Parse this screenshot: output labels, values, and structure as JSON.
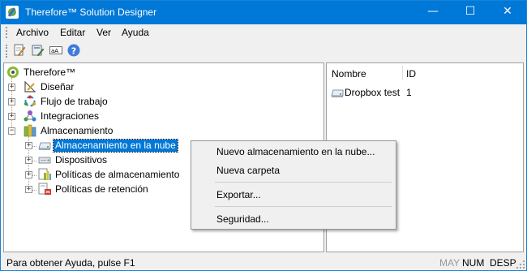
{
  "window": {
    "title": "Therefore™ Solution Designer",
    "controls": {
      "minimize": "—",
      "maximize": "☐",
      "close": "✕"
    }
  },
  "menubar": {
    "items": [
      "Archivo",
      "Editar",
      "Ver",
      "Ayuda"
    ]
  },
  "toolbar": {
    "buttons": [
      {
        "icon": "edit-document-icon"
      },
      {
        "icon": "edit-properties-icon"
      },
      {
        "icon": "rename-icon"
      },
      {
        "icon": "help-icon"
      }
    ]
  },
  "tree": {
    "root": {
      "label": "Therefore™",
      "icon": "therefore-root-icon"
    },
    "nodes": [
      {
        "label": "Diseñar",
        "icon": "design-icon",
        "expander": "+"
      },
      {
        "label": "Flujo de trabajo",
        "icon": "workflow-icon",
        "expander": "+"
      },
      {
        "label": "Integraciones",
        "icon": "integrations-icon",
        "expander": "+"
      },
      {
        "label": "Almacenamiento",
        "icon": "storage-icon",
        "expander": "−"
      }
    ],
    "storage_children": [
      {
        "label": "Almacenamiento en la nube",
        "icon": "cloud-storage-icon",
        "expander": "+",
        "selected": true
      },
      {
        "label": "Dispositivos",
        "icon": "devices-icon",
        "expander": "+"
      },
      {
        "label": "Políticas de almacenamiento",
        "icon": "storage-policies-icon",
        "expander": "+"
      },
      {
        "label": "Políticas de retención",
        "icon": "retention-policies-icon",
        "expander": "+"
      }
    ]
  },
  "list": {
    "columns": [
      "Nombre",
      "ID"
    ],
    "rows": [
      {
        "name": "Dropbox test",
        "id": "1",
        "icon": "cloud-storage-icon"
      }
    ]
  },
  "context_menu": {
    "items": [
      "Nuevo almacenamiento en la nube...",
      "Nueva carpeta",
      "Exportar...",
      "Seguridad..."
    ]
  },
  "statusbar": {
    "text": "Para obtener Ayuda, pulse F1",
    "indicators": [
      {
        "label": "MAY",
        "enabled": false
      },
      {
        "label": "NUM",
        "enabled": true
      },
      {
        "label": "DESP",
        "enabled": true
      }
    ]
  },
  "colors": {
    "titlebar": "#0078d7",
    "selection": "#0078d7",
    "chrome": "#f0f0f0"
  }
}
